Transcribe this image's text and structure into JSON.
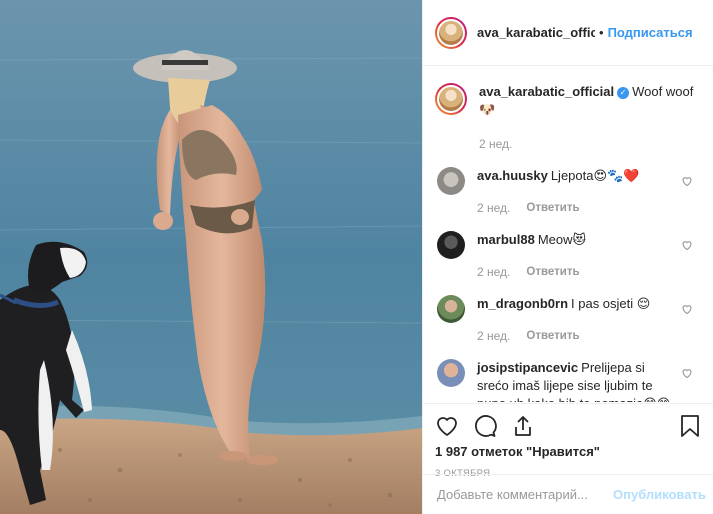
{
  "post": {
    "author": "ava_karabatic_offici",
    "follow_label": "Подписаться",
    "dot": "•",
    "more": "•••"
  },
  "caption": {
    "author": "ava_karabatic_official",
    "text": "Woof woof 🐶",
    "time": "2 нед."
  },
  "comments": [
    {
      "user": "ava.huusky",
      "text": "Ljepota😍🐾❤️",
      "time": "2 нед.",
      "reply": "Ответить"
    },
    {
      "user": "marbul88",
      "text": "Meow😻",
      "time": "2 нед.",
      "reply": "Ответить"
    },
    {
      "user": "m_dragonb0rn",
      "text": "I pas osjeti 😌",
      "time": "2 нед.",
      "reply": "Ответить"
    },
    {
      "user": "josipstipancevic",
      "text": "Prelijepa si srećo imaš lijepe sise ljubim te puno uh kako bih te pomazio😋😋😋😋😋"
    }
  ],
  "likes": "1 987 отметок \"Нравится\"",
  "date": "3 октября",
  "add_comment": {
    "placeholder": "Добавьте комментарий...",
    "publish": "Опубликовать"
  }
}
